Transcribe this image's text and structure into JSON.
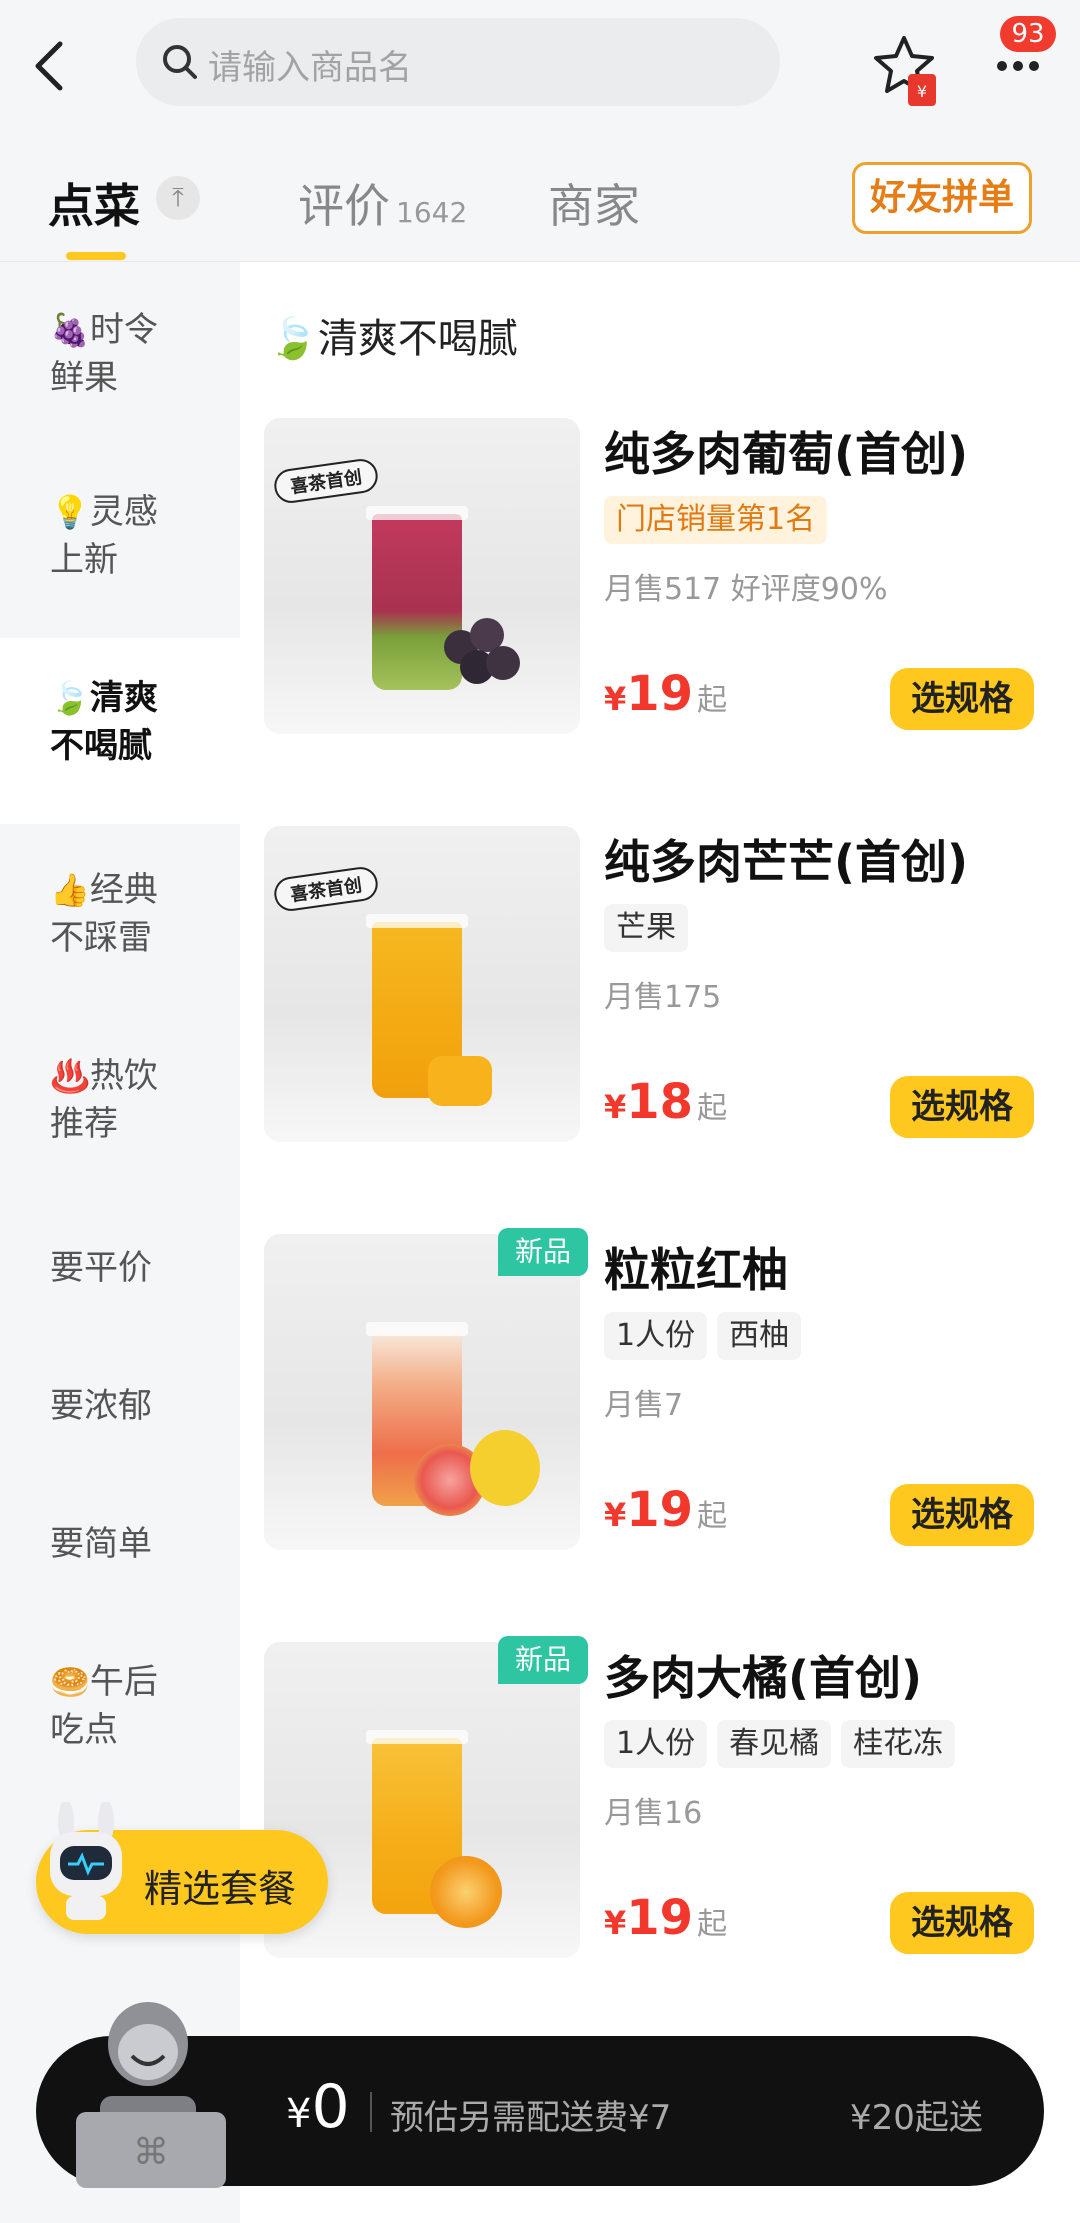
{
  "search": {
    "placeholder": "请输入商品名"
  },
  "header": {
    "message_badge": "93"
  },
  "tabs": {
    "order": "点菜",
    "reviews": "评价",
    "reviews_count": "1642",
    "merchant": "商家",
    "group_order": "好友拼单"
  },
  "sidebar": {
    "items": [
      {
        "emoji": "🍇",
        "line1": "时令",
        "line2": "鲜果"
      },
      {
        "emoji": "💡",
        "line1": "灵感",
        "line2": "上新"
      },
      {
        "emoji": "🍃",
        "line1": "清爽",
        "line2": "不喝腻"
      },
      {
        "emoji": "👍",
        "line1": "经典",
        "line2": "不踩雷"
      },
      {
        "emoji": "♨️",
        "line1": "热饮",
        "line2": "推荐"
      },
      {
        "emoji": "",
        "line1": "要平价",
        "line2": ""
      },
      {
        "emoji": "",
        "line1": "要浓郁",
        "line2": ""
      },
      {
        "emoji": "",
        "line1": "要简单",
        "line2": ""
      },
      {
        "emoji": "🥯",
        "line1": "午后",
        "line2": "吃点"
      }
    ]
  },
  "category": {
    "emoji": "🍃",
    "title": "清爽不喝腻"
  },
  "products": [
    {
      "name": "纯多肉葡萄(首创)",
      "stamp": "喜茶首创",
      "new": "",
      "tags": [
        "门店销量第1名"
      ],
      "sales": "月售517  好评度90%",
      "currency": "¥",
      "price": "19",
      "suffix": "起",
      "button": "选规格"
    },
    {
      "name": "纯多肉芒芒(首创)",
      "stamp": "喜茶首创",
      "new": "",
      "tags": [
        "芒果"
      ],
      "sales": "月售175",
      "currency": "¥",
      "price": "18",
      "suffix": "起",
      "button": "选规格"
    },
    {
      "name": "粒粒红柚",
      "stamp": "",
      "new": "新品",
      "tags": [
        "1人份",
        "西柚"
      ],
      "sales": "月售7",
      "currency": "¥",
      "price": "19",
      "suffix": "起",
      "button": "选规格"
    },
    {
      "name": "多肉大橘(首创)",
      "stamp": "",
      "new": "新品",
      "tags": [
        "1人份",
        "春见橘",
        "桂花冻"
      ],
      "sales": "月售16",
      "currency": "¥",
      "price": "19",
      "suffix": "起",
      "button": "选规格"
    }
  ],
  "combo": {
    "label": "精选套餐"
  },
  "cart": {
    "currency": "¥",
    "total": "0",
    "fee_note": "预估另需配送费¥7",
    "min_order": "¥20起送"
  },
  "colors": {
    "accent": "#ffc81e",
    "price": "#f2372c",
    "new_badge": "#2ec5a3",
    "cart_bg": "#111111"
  },
  "icons": [
    "back-arrow-icon",
    "search-icon",
    "favorite-star-icon",
    "more-dots-icon",
    "pin-top-icon",
    "robot-mascot-icon",
    "courier-mascot-icon"
  ]
}
